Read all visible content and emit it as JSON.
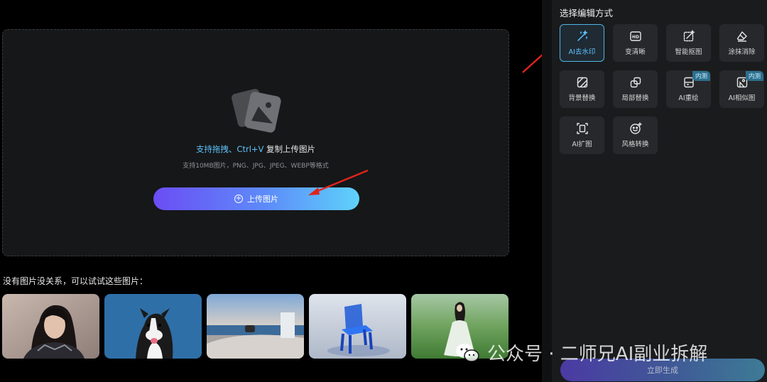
{
  "upload": {
    "hint_highlight": "支持拖拽、Ctrl+V",
    "hint_rest": " 复制上传图片",
    "formats": "支持10MB图片，PNG、JPG、JPEG、WEBP等格式",
    "button_label": "上传图片",
    "button_icon": "plus-circle-icon"
  },
  "samples": {
    "title": "没有图片没关系，可以试试这些图片：",
    "items": [
      "portrait-woman",
      "border-collie-dog",
      "seaside-road",
      "blue-glass-chair",
      "woman-on-meadow"
    ]
  },
  "panel": {
    "title": "选择编辑方式",
    "tools": [
      {
        "label": "AI去水印",
        "icon": "magic-wand-icon",
        "active": true
      },
      {
        "label": "变清晰",
        "icon": "hd-icon"
      },
      {
        "label": "智能抠图",
        "icon": "cutout-icon"
      },
      {
        "label": "涂抹消除",
        "icon": "eraser-icon"
      },
      {
        "label": "背景替换",
        "icon": "background-replace-icon"
      },
      {
        "label": "局部替换",
        "icon": "partial-replace-icon"
      },
      {
        "label": "AI重绘",
        "icon": "redraw-icon",
        "badge": "内测"
      },
      {
        "label": "AI相似图",
        "icon": "similar-image-icon",
        "badge": "内测"
      },
      {
        "label": "AI扩图",
        "icon": "expand-icon"
      },
      {
        "label": "风格转换",
        "icon": "style-transfer-icon"
      }
    ],
    "generate_label": "立即生成"
  },
  "watermark": {
    "text": "公众号 · 二师兄AI副业拆解",
    "icon": "wechat-icon"
  },
  "colors": {
    "accent": "#5ec3ff",
    "annotation_arrow": "#e0241b",
    "panel_bg": "#1a1b1d",
    "upload_bg": "#161718"
  }
}
